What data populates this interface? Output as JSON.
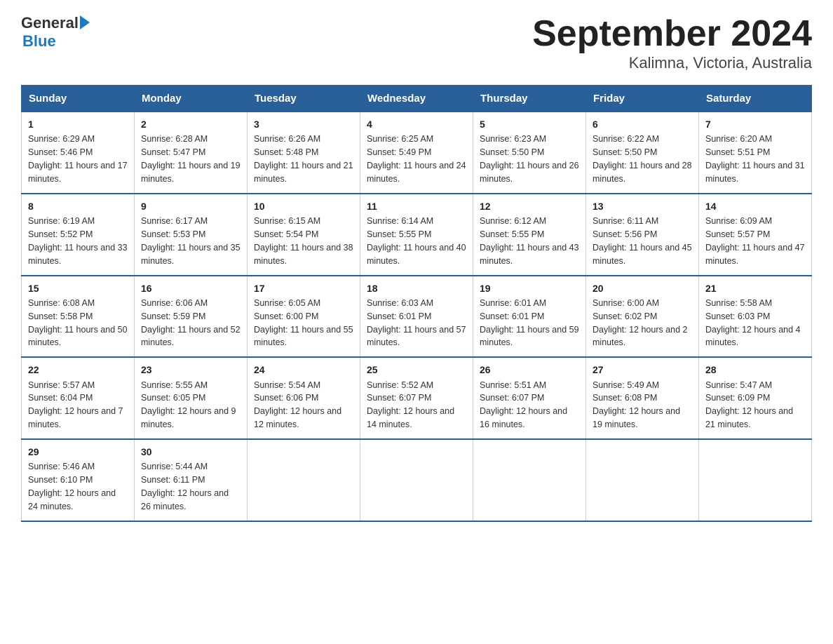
{
  "header": {
    "logo_general": "General",
    "logo_blue": "Blue",
    "title": "September 2024",
    "subtitle": "Kalimna, Victoria, Australia"
  },
  "days_of_week": [
    "Sunday",
    "Monday",
    "Tuesday",
    "Wednesday",
    "Thursday",
    "Friday",
    "Saturday"
  ],
  "weeks": [
    [
      {
        "day": "1",
        "sunrise": "6:29 AM",
        "sunset": "5:46 PM",
        "daylight": "11 hours and 17 minutes."
      },
      {
        "day": "2",
        "sunrise": "6:28 AM",
        "sunset": "5:47 PM",
        "daylight": "11 hours and 19 minutes."
      },
      {
        "day": "3",
        "sunrise": "6:26 AM",
        "sunset": "5:48 PM",
        "daylight": "11 hours and 21 minutes."
      },
      {
        "day": "4",
        "sunrise": "6:25 AM",
        "sunset": "5:49 PM",
        "daylight": "11 hours and 24 minutes."
      },
      {
        "day": "5",
        "sunrise": "6:23 AM",
        "sunset": "5:50 PM",
        "daylight": "11 hours and 26 minutes."
      },
      {
        "day": "6",
        "sunrise": "6:22 AM",
        "sunset": "5:50 PM",
        "daylight": "11 hours and 28 minutes."
      },
      {
        "day": "7",
        "sunrise": "6:20 AM",
        "sunset": "5:51 PM",
        "daylight": "11 hours and 31 minutes."
      }
    ],
    [
      {
        "day": "8",
        "sunrise": "6:19 AM",
        "sunset": "5:52 PM",
        "daylight": "11 hours and 33 minutes."
      },
      {
        "day": "9",
        "sunrise": "6:17 AM",
        "sunset": "5:53 PM",
        "daylight": "11 hours and 35 minutes."
      },
      {
        "day": "10",
        "sunrise": "6:15 AM",
        "sunset": "5:54 PM",
        "daylight": "11 hours and 38 minutes."
      },
      {
        "day": "11",
        "sunrise": "6:14 AM",
        "sunset": "5:55 PM",
        "daylight": "11 hours and 40 minutes."
      },
      {
        "day": "12",
        "sunrise": "6:12 AM",
        "sunset": "5:55 PM",
        "daylight": "11 hours and 43 minutes."
      },
      {
        "day": "13",
        "sunrise": "6:11 AM",
        "sunset": "5:56 PM",
        "daylight": "11 hours and 45 minutes."
      },
      {
        "day": "14",
        "sunrise": "6:09 AM",
        "sunset": "5:57 PM",
        "daylight": "11 hours and 47 minutes."
      }
    ],
    [
      {
        "day": "15",
        "sunrise": "6:08 AM",
        "sunset": "5:58 PM",
        "daylight": "11 hours and 50 minutes."
      },
      {
        "day": "16",
        "sunrise": "6:06 AM",
        "sunset": "5:59 PM",
        "daylight": "11 hours and 52 minutes."
      },
      {
        "day": "17",
        "sunrise": "6:05 AM",
        "sunset": "6:00 PM",
        "daylight": "11 hours and 55 minutes."
      },
      {
        "day": "18",
        "sunrise": "6:03 AM",
        "sunset": "6:01 PM",
        "daylight": "11 hours and 57 minutes."
      },
      {
        "day": "19",
        "sunrise": "6:01 AM",
        "sunset": "6:01 PM",
        "daylight": "11 hours and 59 minutes."
      },
      {
        "day": "20",
        "sunrise": "6:00 AM",
        "sunset": "6:02 PM",
        "daylight": "12 hours and 2 minutes."
      },
      {
        "day": "21",
        "sunrise": "5:58 AM",
        "sunset": "6:03 PM",
        "daylight": "12 hours and 4 minutes."
      }
    ],
    [
      {
        "day": "22",
        "sunrise": "5:57 AM",
        "sunset": "6:04 PM",
        "daylight": "12 hours and 7 minutes."
      },
      {
        "day": "23",
        "sunrise": "5:55 AM",
        "sunset": "6:05 PM",
        "daylight": "12 hours and 9 minutes."
      },
      {
        "day": "24",
        "sunrise": "5:54 AM",
        "sunset": "6:06 PM",
        "daylight": "12 hours and 12 minutes."
      },
      {
        "day": "25",
        "sunrise": "5:52 AM",
        "sunset": "6:07 PM",
        "daylight": "12 hours and 14 minutes."
      },
      {
        "day": "26",
        "sunrise": "5:51 AM",
        "sunset": "6:07 PM",
        "daylight": "12 hours and 16 minutes."
      },
      {
        "day": "27",
        "sunrise": "5:49 AM",
        "sunset": "6:08 PM",
        "daylight": "12 hours and 19 minutes."
      },
      {
        "day": "28",
        "sunrise": "5:47 AM",
        "sunset": "6:09 PM",
        "daylight": "12 hours and 21 minutes."
      }
    ],
    [
      {
        "day": "29",
        "sunrise": "5:46 AM",
        "sunset": "6:10 PM",
        "daylight": "12 hours and 24 minutes."
      },
      {
        "day": "30",
        "sunrise": "5:44 AM",
        "sunset": "6:11 PM",
        "daylight": "12 hours and 26 minutes."
      },
      null,
      null,
      null,
      null,
      null
    ]
  ]
}
